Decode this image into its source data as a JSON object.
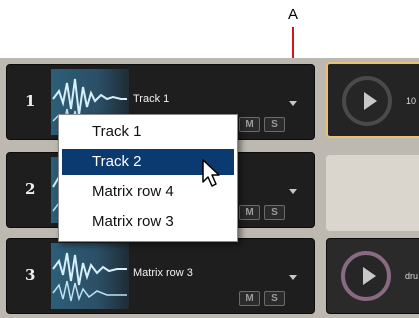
{
  "callout": {
    "letter": "A"
  },
  "rows": [
    {
      "number": "1",
      "track_label": "Track 1",
      "mute": "M",
      "solo": "S"
    },
    {
      "number": "2",
      "track_label": "",
      "mute": "M",
      "solo": "S"
    },
    {
      "number": "3",
      "track_label": "Matrix row 3",
      "mute": "M",
      "solo": "S"
    }
  ],
  "clips": [
    {
      "text": "10"
    },
    {
      "text": ""
    },
    {
      "text": "dru"
    }
  ],
  "track_menu": {
    "items": [
      "Track 1",
      "Track 2",
      "Matrix row 4",
      "Matrix row 3"
    ],
    "selected": "Track 2"
  },
  "colors": {
    "callout_arrow": "#d01818",
    "menu_selection": "#0b3a70",
    "clip_active_border": "#e8c078"
  }
}
